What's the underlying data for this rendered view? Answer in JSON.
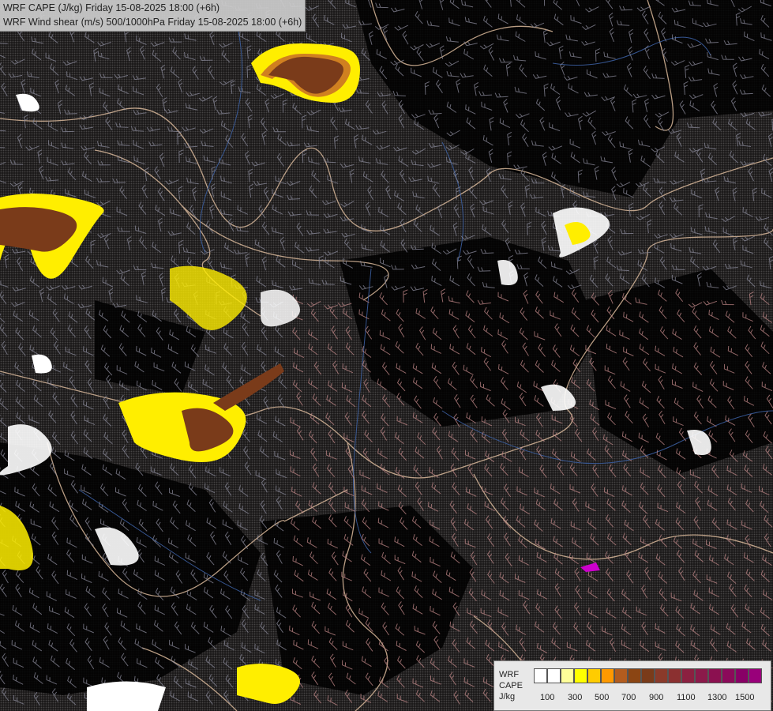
{
  "title": {
    "line1": "WRF CAPE (J/kg) Friday 15-08-2025 18:00 (+6h)",
    "line2": "WRF Wind shear (m/s) 500/1000hPa Friday 15-08-2025 18:00 (+6h)"
  },
  "legend": {
    "line1": "WRF",
    "line2": "CAPE",
    "line3": "J/kg",
    "colors": [
      "#ffffff",
      "#ffffff",
      "#ffff99",
      "#ffff00",
      "#ffcc00",
      "#ff9900",
      "#b35c1e",
      "#8b4513",
      "#7a3b1a",
      "#8a3a2a",
      "#8b3030",
      "#8b2040",
      "#8b1a4a",
      "#8b1050",
      "#8b0a5a",
      "#880066",
      "#99007a"
    ],
    "labels": [
      "100",
      "300",
      "500",
      "700",
      "900",
      "1100",
      "1300",
      "1500"
    ]
  },
  "colors": {
    "background": "#1c1a1a",
    "borders": "#d9b89a",
    "rivers": "#3b5ea0",
    "barbs_low": "#8a8aa0",
    "barbs_high": "#c08080",
    "cape_yellow": "#ffee00",
    "cape_brown": "#7a3b1a"
  }
}
